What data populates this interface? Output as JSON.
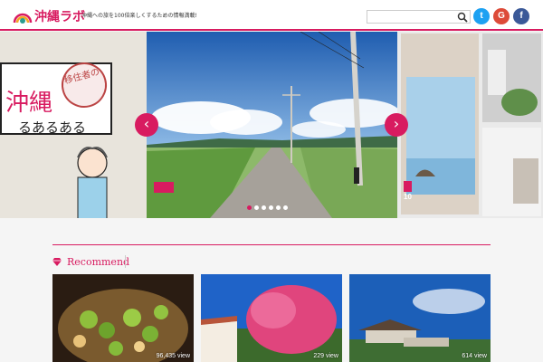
{
  "header": {
    "site_name": "沖縄ラボ",
    "tagline": "沖縄への旅を100倍楽しくするための情報満載!",
    "search_placeholder": "",
    "social": {
      "twitter": "t",
      "googleplus": "G",
      "facebook": "f"
    }
  },
  "hero": {
    "left_sign_line1": "沖縄",
    "left_sign_line2": "るあるある",
    "left_stamp": "移住者の",
    "arrow_left": "‹",
    "arrow_right": "›",
    "slide_count": 6,
    "active_slide": 0,
    "right_count": "10"
  },
  "recommend": {
    "title": "Recommend",
    "cards": [
      {
        "views": "96,435 view"
      },
      {
        "views": "229 view"
      },
      {
        "views": "614 view"
      }
    ]
  },
  "colors": {
    "accent": "#d81b60",
    "twitter": "#1da1f2",
    "googleplus": "#dd4b39",
    "facebook": "#3b5998"
  }
}
